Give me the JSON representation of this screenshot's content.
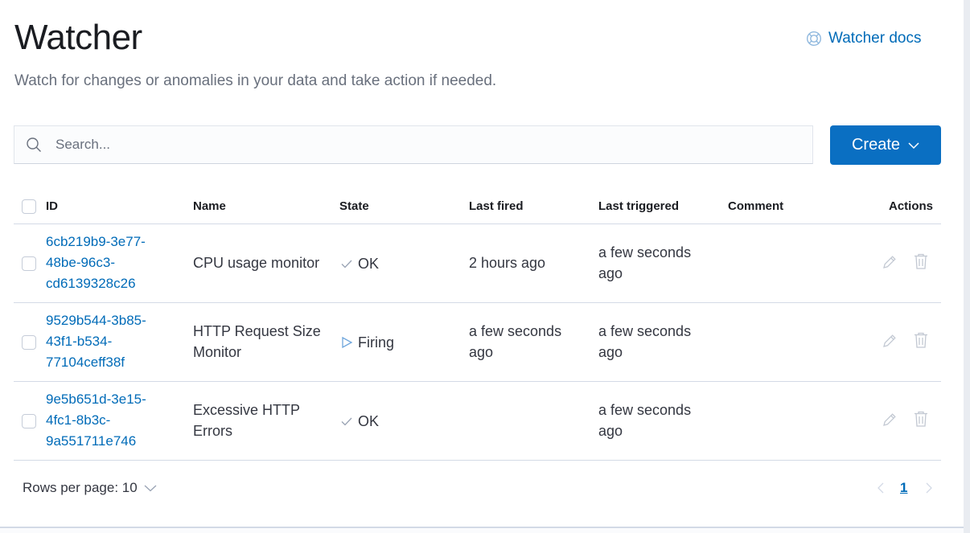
{
  "header": {
    "title": "Watcher",
    "subtitle": "Watch for changes or anomalies in your data and take action if needed.",
    "docs_link": "Watcher docs"
  },
  "search": {
    "placeholder": "Search..."
  },
  "create_button": {
    "label": "Create"
  },
  "table": {
    "columns": [
      "ID",
      "Name",
      "State",
      "Last fired",
      "Last triggered",
      "Comment",
      "Actions"
    ],
    "rows": [
      {
        "id_lines": [
          "6cb219b9-3e77-",
          "48be-96c3-",
          "cd6139328c26"
        ],
        "name_lines": [
          "CPU usage monitor"
        ],
        "state": "OK",
        "state_icon": "check-icon",
        "last_fired_lines": [
          "2 hours ago"
        ],
        "last_triggered_lines": [
          "a few seconds",
          "ago"
        ],
        "comment": ""
      },
      {
        "id_lines": [
          "9529b544-3b85-",
          "43f1-b534-",
          "77104ceff38f"
        ],
        "name_lines": [
          "HTTP Request Size",
          "Monitor"
        ],
        "state": "Firing",
        "state_icon": "play-icon",
        "last_fired_lines": [
          "a few seconds",
          "ago"
        ],
        "last_triggered_lines": [
          "a few seconds",
          "ago"
        ],
        "comment": ""
      },
      {
        "id_lines": [
          "9e5b651d-3e15-",
          "4fc1-8b3c-",
          "9a551711e746"
        ],
        "name_lines": [
          "Excessive HTTP",
          "Errors"
        ],
        "state": "OK",
        "state_icon": "check-icon",
        "last_fired_lines": [],
        "last_triggered_lines": [
          "a few seconds",
          "ago"
        ],
        "comment": ""
      }
    ]
  },
  "pagination": {
    "rows_per_page_label": "Rows per page: 10",
    "current_page": "1"
  },
  "colors": {
    "primary": "#0a6fc2",
    "link": "#006bb8",
    "text": "#343741",
    "muted": "#69707d",
    "border": "#d3dae6"
  }
}
